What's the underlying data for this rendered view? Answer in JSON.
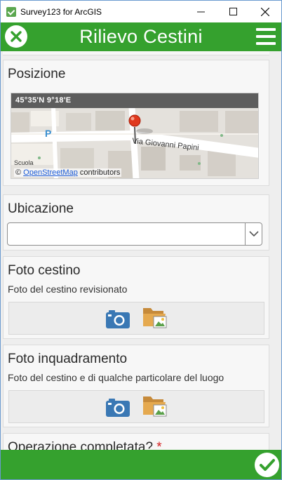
{
  "window": {
    "title": "Survey123 for ArcGIS"
  },
  "header": {
    "title": "Rilievo Cestini"
  },
  "sections": {
    "posizione": {
      "title": "Posizione",
      "coords": "45°35'N  9°18'E",
      "map_road": "Via Giovanni Papini",
      "map_place": "Scuola",
      "map_parking": "P",
      "attribution_prefix": "©",
      "attribution_link": "OpenStreetMap",
      "attribution_suffix": "contributors"
    },
    "ubicazione": {
      "title": "Ubicazione",
      "value": ""
    },
    "foto_cestino": {
      "title": "Foto cestino",
      "hint": "Foto del cestino revisionato"
    },
    "foto_inquadramento": {
      "title": "Foto inquadramento",
      "hint": "Foto del cestino e di qualche particolare del luogo"
    },
    "operazione": {
      "title": "Operazione completata?",
      "required_mark": "*"
    }
  },
  "colors": {
    "brand_green": "#35a12e",
    "camera_blue": "#3a78b4",
    "required_red": "#d32020"
  },
  "icons": {
    "close": "close-icon",
    "menu": "menu-icon",
    "camera": "camera-icon",
    "folder": "folder-image-icon",
    "submit": "check-icon",
    "map_pin": "map-pin-icon"
  }
}
